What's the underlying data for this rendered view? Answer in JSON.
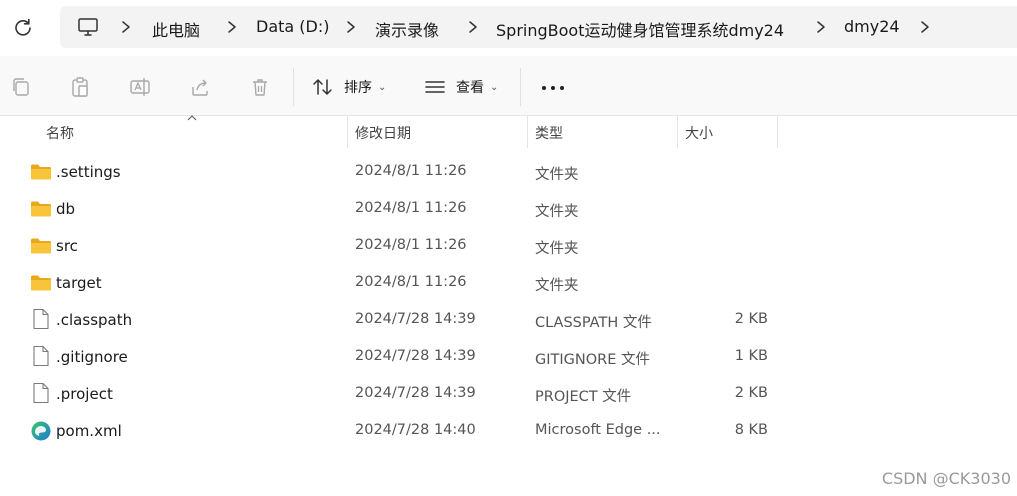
{
  "breadcrumb": [
    "此电脑",
    "Data (D:)",
    "演示录像",
    "SpringBoot运动健身馆管理系统dmy24",
    "dmy24"
  ],
  "toolbar": {
    "sort_label": "排序",
    "view_label": "查看",
    "icons": [
      "copy-icon",
      "paste-icon",
      "rename-icon",
      "share-icon",
      "delete-icon"
    ]
  },
  "columns": {
    "name": "名称",
    "date": "修改日期",
    "type": "类型",
    "size": "大小"
  },
  "files": [
    {
      "name": ".settings",
      "date": "2024/8/1 11:26",
      "type": "文件夹",
      "size": "",
      "kind": "folder"
    },
    {
      "name": "db",
      "date": "2024/8/1 11:26",
      "type": "文件夹",
      "size": "",
      "kind": "folder"
    },
    {
      "name": "src",
      "date": "2024/8/1 11:26",
      "type": "文件夹",
      "size": "",
      "kind": "folder"
    },
    {
      "name": "target",
      "date": "2024/8/1 11:26",
      "type": "文件夹",
      "size": "",
      "kind": "folder"
    },
    {
      "name": ".classpath",
      "date": "2024/7/28 14:39",
      "type": "CLASSPATH 文件",
      "size": "2 KB",
      "kind": "file"
    },
    {
      "name": ".gitignore",
      "date": "2024/7/28 14:39",
      "type": "GITIGNORE 文件",
      "size": "1 KB",
      "kind": "file"
    },
    {
      "name": ".project",
      "date": "2024/7/28 14:39",
      "type": "PROJECT 文件",
      "size": "2 KB",
      "kind": "file"
    },
    {
      "name": "pom.xml",
      "date": "2024/7/28 14:40",
      "type": "Microsoft Edge ...",
      "size": "8 KB",
      "kind": "edge"
    }
  ],
  "watermark": "CSDN @CK3030",
  "colors": {
    "folder": "#f8c43a",
    "folder_dark": "#e7a81d",
    "edge_blue": "#1b7bd6",
    "edge_green": "#3cc46c"
  }
}
